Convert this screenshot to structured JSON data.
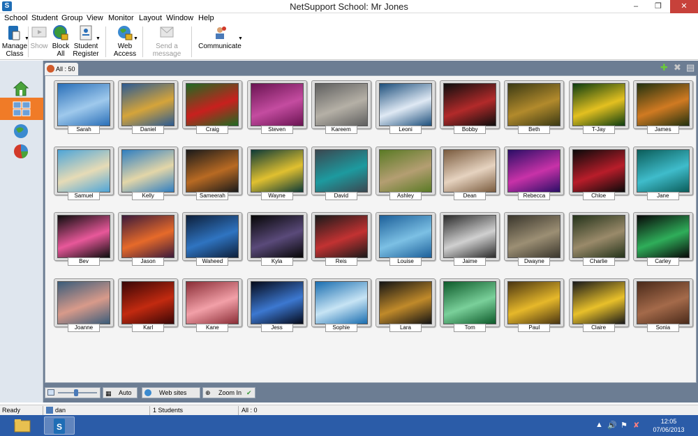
{
  "window": {
    "title": "NetSupport School: Mr Jones"
  },
  "menu": [
    "School",
    "Student",
    "Group",
    "View",
    "Monitor",
    "Layout",
    "Window",
    "Help"
  ],
  "toolbar": {
    "manage_class": [
      "Manage",
      "Class"
    ],
    "show": "Show",
    "block_all": [
      "Block",
      "All"
    ],
    "student_register": [
      "Student",
      "Register"
    ],
    "web_access": [
      "Web",
      "Access"
    ],
    "send_message": [
      "Send a",
      "message"
    ],
    "communicate": "Communicate"
  },
  "tab": {
    "label": "All : 50"
  },
  "students": [
    "Sarah",
    "Daniel",
    "Craig",
    "Steven",
    "Kareem",
    "Leoni",
    "Bobby",
    "Beth",
    "T-Jay",
    "James",
    "Samuel",
    "Kelly",
    "Sameerah",
    "Wayne",
    "David",
    "Ashley",
    "Dean",
    "Rebecca",
    "Chloe",
    "Jane",
    "Bev",
    "Jason",
    "Waheed",
    "Kyla",
    "Reis",
    "Louise",
    "Jaime",
    "Dwayne",
    "Charlie",
    "Carley",
    "Joanne",
    "Karl",
    "Kane",
    "Jess",
    "Sophie",
    "Lara",
    "Tom",
    "Paul",
    "Claire",
    "Sonia"
  ],
  "thumb_colors": [
    [
      "#2a6fb8",
      "#9fc9ec"
    ],
    [
      "#2b5a93",
      "#d5a43a"
    ],
    [
      "#1e6b22",
      "#c8201e"
    ],
    [
      "#6a1452",
      "#c44ca0"
    ],
    [
      "#5f5f5f",
      "#b5b0a6"
    ],
    [
      "#1d4f7c",
      "#dfe9f4"
    ],
    [
      "#0e0e0e",
      "#b22a2a"
    ],
    [
      "#3b3a14",
      "#b28a2c"
    ],
    [
      "#0c3d10",
      "#e3c020"
    ],
    [
      "#22320f",
      "#d07a22"
    ],
    [
      "#4ea5d8",
      "#e6dbb6"
    ],
    [
      "#2f7ec1",
      "#e3d6a8"
    ],
    [
      "#1a1a1a",
      "#b86a23"
    ],
    [
      "#0d3a37",
      "#e0c030"
    ],
    [
      "#3b4750",
      "#1d9a9f"
    ],
    [
      "#5a7a25",
      "#b49e72"
    ],
    [
      "#7a5b3e",
      "#e6d3c0"
    ],
    [
      "#2a0e66",
      "#c832a8"
    ],
    [
      "#0a0a0a",
      "#b81d2a"
    ],
    [
      "#0b5d5a",
      "#3fbccb"
    ],
    [
      "#0d0d0d",
      "#e8589a"
    ],
    [
      "#3b1a3b",
      "#e66a2a"
    ],
    [
      "#0d1f3a",
      "#2f74c1"
    ],
    [
      "#060606",
      "#5a4a7a"
    ],
    [
      "#1a1a1a",
      "#c23232"
    ],
    [
      "#1c5f99",
      "#7cc0e4"
    ],
    [
      "#2b2b2b",
      "#d0d0d0"
    ],
    [
      "#3a362c",
      "#9c8f74"
    ],
    [
      "#24331a",
      "#9a8a6a"
    ],
    [
      "#080808",
      "#2fae5a"
    ],
    [
      "#3a5c7a",
      "#d89a8a"
    ],
    [
      "#3a0606",
      "#c22a10"
    ],
    [
      "#8a2d36",
      "#f2a0a8"
    ],
    [
      "#050a1a",
      "#3c78d0"
    ],
    [
      "#1a6eb0",
      "#c7e4f4"
    ],
    [
      "#141414",
      "#c08a2a"
    ],
    [
      "#0d5a2a",
      "#7ad09a"
    ],
    [
      "#4a3512",
      "#e6b82a"
    ],
    [
      "#1a1a1a",
      "#e8c02a"
    ],
    [
      "#4a2a1a",
      "#a46a4a"
    ]
  ],
  "bottom_bar": {
    "auto": "Auto",
    "web_sites": "Web sites",
    "zoom_in": "Zoom In"
  },
  "status": {
    "ready": "Ready",
    "user": "dan",
    "students": "1 Students",
    "all": "All : 0"
  },
  "clock": {
    "time": "12:05",
    "date": "07/06/2013"
  }
}
